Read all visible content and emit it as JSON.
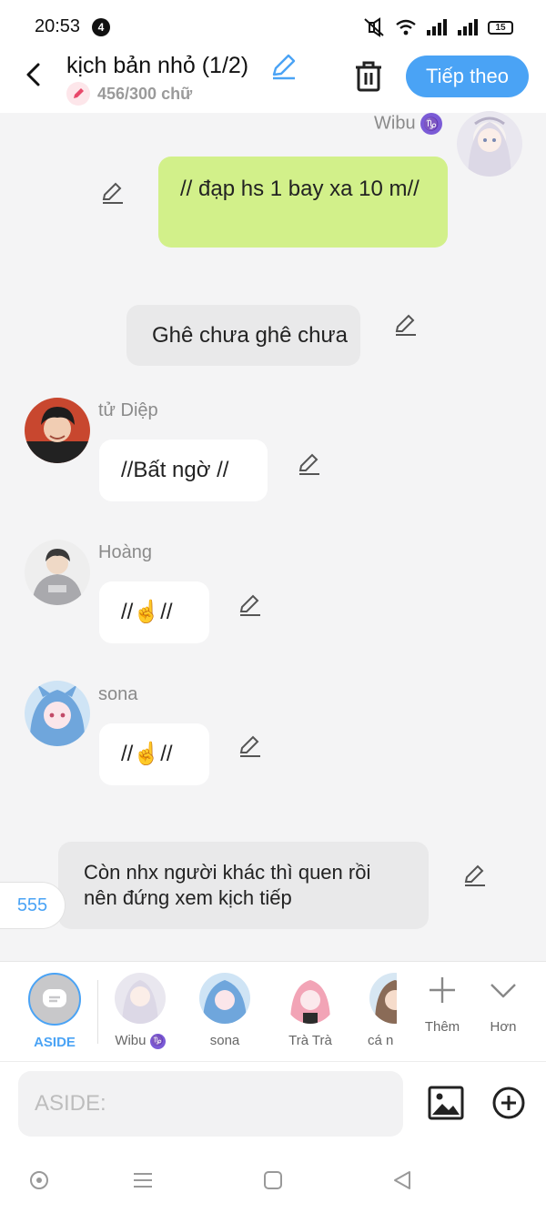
{
  "status_bar": {
    "time": "20:53",
    "notif_count": "4",
    "battery": "15"
  },
  "header": {
    "title": "kịch bản nhỏ (1/2)",
    "word_count": "456/300 chữ",
    "next_label": "Tiếp theo"
  },
  "messages": [
    {
      "sender": "Wibu",
      "text": "// đạp hs 1 bay xa 10 m//"
    },
    {
      "text": "Ghê chưa ghê chưa"
    },
    {
      "sender": "tử Diệp",
      "text": "//Bất ngờ //"
    },
    {
      "sender": "Hoàng",
      "text": "//☝️//"
    },
    {
      "sender": "sona",
      "text": "//☝️//"
    },
    {
      "text": "Còn nhx người khác thì quen rồi nên đứng xem kịch tiếp"
    }
  ],
  "side_tag": "555",
  "characters": [
    {
      "label": "ASIDE"
    },
    {
      "label": "Wibu"
    },
    {
      "label": "sona"
    },
    {
      "label": "Trà Trà"
    },
    {
      "label": "cá n"
    }
  ],
  "actions": {
    "more_label": "Thêm",
    "expand_label": "Hơn"
  },
  "input": {
    "placeholder": "ASIDE:"
  },
  "colors": {
    "accent": "#4aa3f5",
    "user_bubble": "#d2f08a",
    "aside_bubble": "#e9e9ea"
  }
}
